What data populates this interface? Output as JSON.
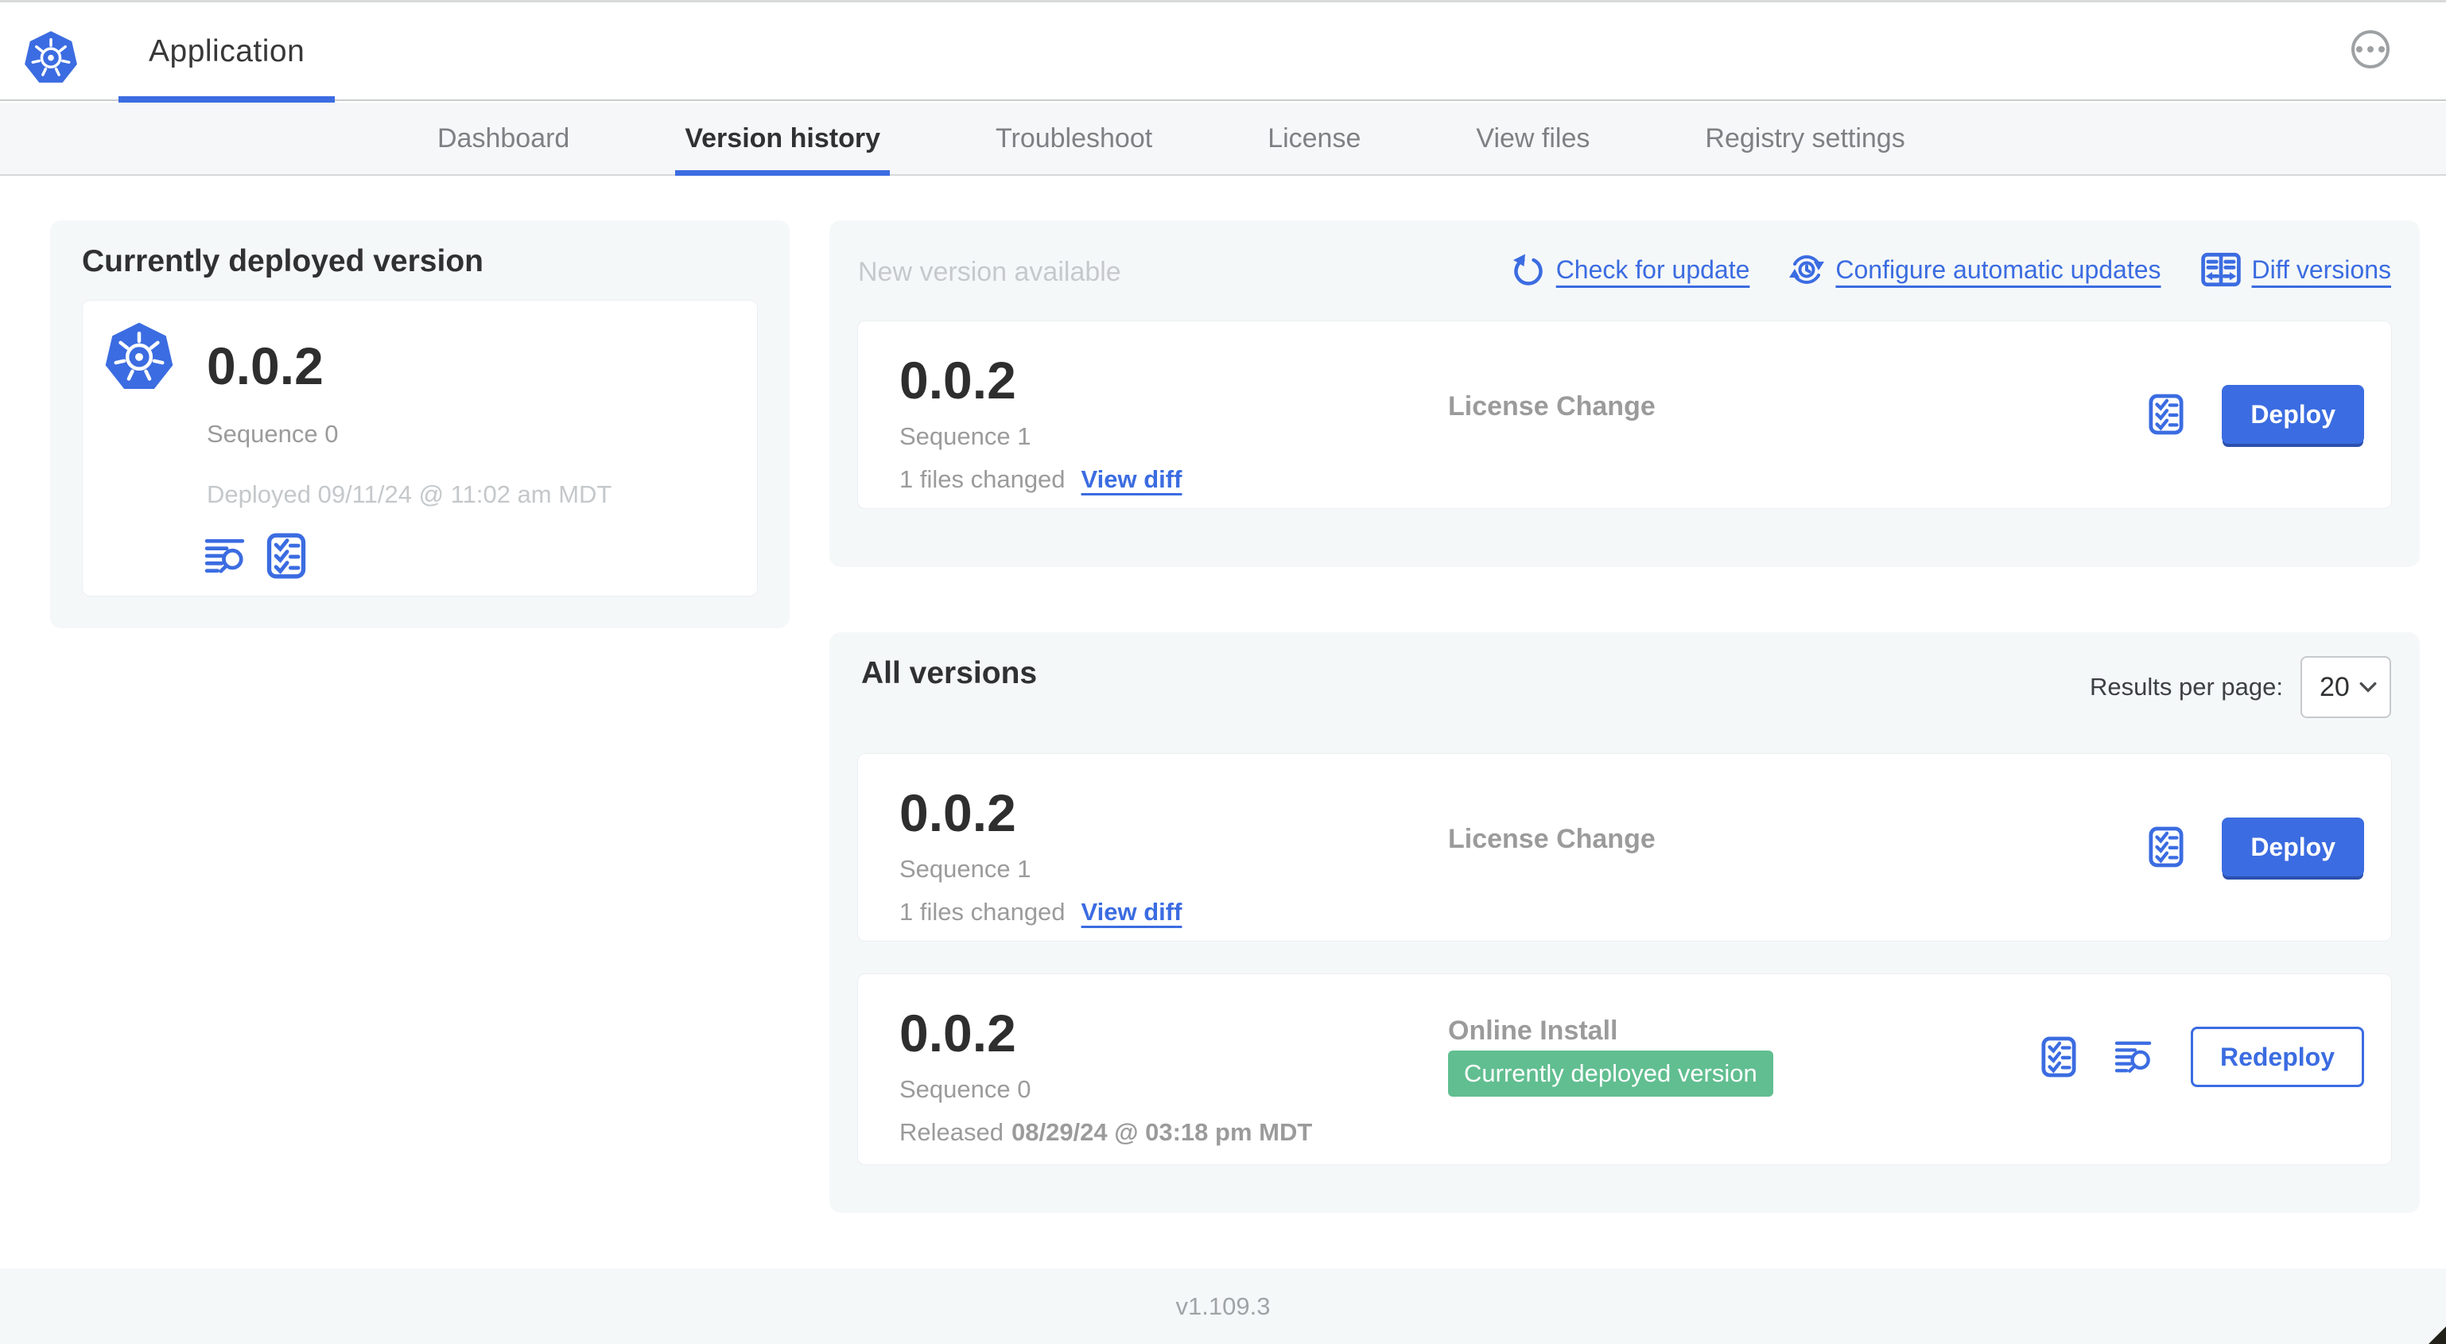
{
  "header": {
    "app_title": "Application"
  },
  "nav": {
    "tabs": [
      {
        "label": "Dashboard"
      },
      {
        "label": "Version history"
      },
      {
        "label": "Troubleshoot"
      },
      {
        "label": "License"
      },
      {
        "label": "View files"
      },
      {
        "label": "Registry settings"
      }
    ]
  },
  "deployed_card": {
    "title": "Currently deployed version",
    "version": "0.0.2",
    "sequence": "Sequence 0",
    "deployed": "Deployed 09/11/24 @ 11:02 am MDT"
  },
  "new_version": {
    "title": "New version available",
    "check_link": "Check for update",
    "configure_link": "Configure automatic updates",
    "diff_link": "Diff versions",
    "row": {
      "version": "0.0.2",
      "sequence": "Sequence 1",
      "files_changed": "1 files changed",
      "view_diff": "View diff",
      "source": "License Change",
      "deploy": "Deploy"
    }
  },
  "all_versions": {
    "title": "All versions",
    "results_label": "Results per page:",
    "results_value": "20",
    "row1": {
      "version": "0.0.2",
      "sequence": "Sequence 1",
      "files_changed": "1 files changed",
      "view_diff": "View diff",
      "source": "License Change",
      "deploy": "Deploy"
    },
    "row2": {
      "version": "0.0.2",
      "sequence": "Sequence 0",
      "released_prefix": "Released",
      "released_date": "08/29/24 @ 03:18 pm MDT",
      "source": "Online Install",
      "badge": "Currently deployed version",
      "redeploy": "Redeploy"
    }
  },
  "footer": {
    "version": "v1.109.3"
  },
  "icons": {
    "kubernetes-logo": "blue heptagon with white ship wheel",
    "logs-icon": "text lines with magnifier",
    "checklist-icon": "bordered checklist with checkmarks",
    "refresh-icon": "circular arrow",
    "schedule-icon": "clock with circular arrows",
    "diff-icon": "split panes with arrows",
    "ellipsis-icon": "three dots in circle",
    "chevron-down-icon": "select chevron"
  },
  "colors": {
    "accent_blue": "#3b6ce1",
    "badge_green": "#61be90",
    "panel_bg": "#f5f8f9",
    "text_dark": "#323232",
    "text_muted": "#9b9b9b",
    "text_faint": "#c4c8cb"
  }
}
